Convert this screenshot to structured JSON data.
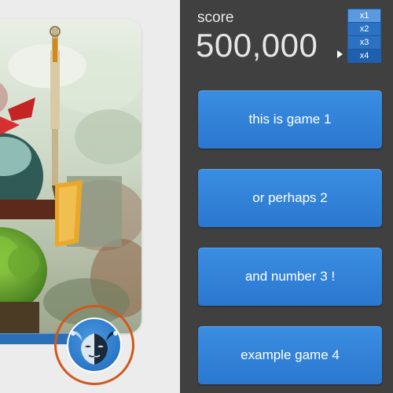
{
  "score": {
    "label": "score",
    "value": "500,000"
  },
  "multipliers": {
    "items": [
      "x1",
      "x2",
      "x3",
      "x4"
    ],
    "selected": "x4"
  },
  "games": [
    {
      "label": "this is game 1"
    },
    {
      "label": "or perhaps 2"
    },
    {
      "label": "and number 3 !"
    },
    {
      "label": "example game 4"
    }
  ],
  "colors": {
    "panel_bg": "#404040",
    "button_blue": "#2f7fd6",
    "avatar_ring": "#d2581a",
    "page_bg": "#eeeeee"
  },
  "icons": {
    "avatar": "jester-mask-icon",
    "pointer": "triangle-right-icon"
  }
}
